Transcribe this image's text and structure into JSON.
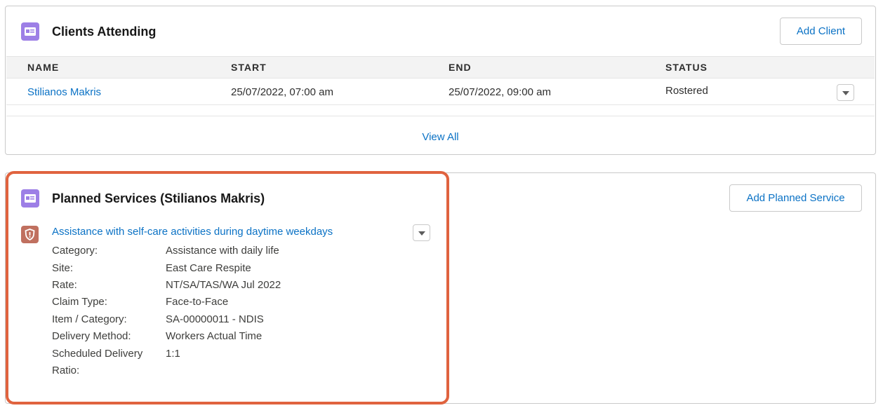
{
  "clients_card": {
    "title": "Clients Attending",
    "add_button": "Add Client",
    "columns": [
      "NAME",
      "START",
      "END",
      "STATUS"
    ],
    "rows": [
      {
        "name": "Stilianos Makris",
        "start": "25/07/2022, 07:00 am",
        "end": "25/07/2022, 09:00 am",
        "status": "Rostered"
      }
    ],
    "view_all": "View All"
  },
  "planned_card": {
    "title": "Planned Services (Stilianos Makris)",
    "add_button": "Add Planned Service",
    "service": {
      "name": "Assistance with self-care activities during daytime weekdays",
      "fields": [
        {
          "label": "Category:",
          "value": "Assistance with daily life"
        },
        {
          "label": "Site:",
          "value": "East Care Respite"
        },
        {
          "label": "Rate:",
          "value": "NT/SA/TAS/WA Jul 2022"
        },
        {
          "label": "Claim Type:",
          "value": "Face-to-Face"
        },
        {
          "label": "Item / Category:",
          "value": "SA-00000011 - NDIS"
        },
        {
          "label": "Delivery Method:",
          "value": "Workers Actual Time"
        },
        {
          "label": "Scheduled Delivery",
          "value": "1:1"
        },
        {
          "label": "Ratio:",
          "value": ""
        }
      ]
    }
  },
  "icons": {
    "card_icon": "contact-card-icon",
    "service_icon": "shield-icon",
    "menu_icon": "chevron-down-icon"
  },
  "colors": {
    "accent_link": "#0b72c5",
    "card_icon_bg": "#9d7fe6",
    "service_icon_bg": "#c0705f",
    "highlight_border": "#e0633f"
  }
}
